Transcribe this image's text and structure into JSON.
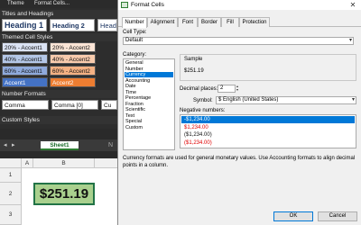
{
  "menubar": {
    "theme": "Theme",
    "format_cells": "Format Cells..."
  },
  "styles_panel": {
    "titles_heading": "Titles and Headings",
    "heading1": "Heading 1",
    "heading2": "Heading 2",
    "heading3": "Head",
    "themed_heading": "Themed Cell Styles",
    "themed": [
      {
        "label": "20% - Accent1",
        "bg": "#dbe3f4",
        "fg": "#111111"
      },
      {
        "label": "20% - Accent2",
        "bg": "#fbe5d6",
        "fg": "#111111"
      },
      {
        "label": "40% - Accent1",
        "bg": "#b4c7e7",
        "fg": "#111111"
      },
      {
        "label": "40% - Accent2",
        "bg": "#f8cbad",
        "fg": "#111111"
      },
      {
        "label": "60% - Accent1",
        "bg": "#8faadc",
        "fg": "#111111"
      },
      {
        "label": "60% - Accent2",
        "bg": "#f4b183",
        "fg": "#111111"
      },
      {
        "label": "Accent1",
        "bg": "#4472c4",
        "fg": "#ffffff"
      },
      {
        "label": "Accent2",
        "bg": "#ed7d31",
        "fg": "#ffffff"
      }
    ],
    "number_heading": "Number Formats",
    "comma": "Comma",
    "comma0": "Comma [0]",
    "number_partial": "Cu",
    "custom_heading": "Custom Styles"
  },
  "sheet": {
    "tab_label": "Sheet1",
    "nav_prev": "◂",
    "nav_next": "▸",
    "col_a": "A",
    "col_b": "B",
    "row1": "1",
    "row2": "2",
    "row3": "3",
    "cell_b2": "$251.19",
    "side_letter": "N"
  },
  "dialog": {
    "title": "Format Cells",
    "close": "✕",
    "tabs": [
      "Number",
      "Alignment",
      "Font",
      "Border",
      "Fill",
      "Protection"
    ],
    "cell_type_label": "Cell Type:",
    "cell_type_value": "Default",
    "category_label": "Category:",
    "categories": [
      "General",
      "Number",
      "Currency",
      "Accounting",
      "Date",
      "Time",
      "Percentage",
      "Fraction",
      "Scientific",
      "Text",
      "Special",
      "Custom"
    ],
    "selected_category": "Currency",
    "sample_label": "Sample",
    "sample_value": "$251.19",
    "decimal_label": "Decimal places:",
    "decimal_value": "2",
    "symbol_label": "Symbol:",
    "symbol_value": "$ English (United States)",
    "negative_label": "Negative numbers:",
    "negatives": [
      {
        "text": "-$1,234.00",
        "color": "#ffffff"
      },
      {
        "text": "$1,234.00",
        "color": "#e00000"
      },
      {
        "text": "($1,234.00)",
        "color": "#111111"
      },
      {
        "text": "($1,234.00)",
        "color": "#e00000"
      }
    ],
    "description": "Currency formats are used for general monetary values. Use Accounting formats to align decimal points in a column.",
    "ok": "OK",
    "cancel": "Cancel"
  }
}
